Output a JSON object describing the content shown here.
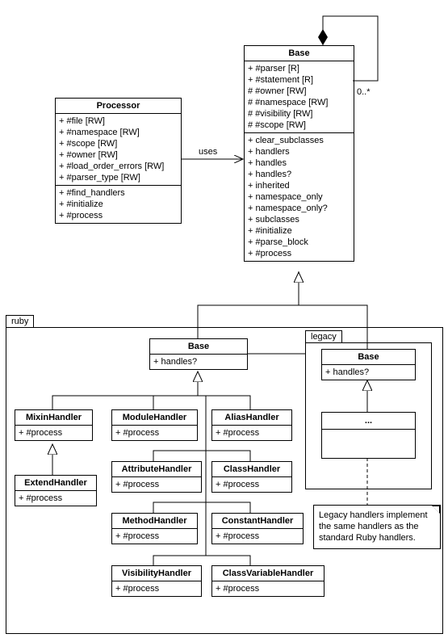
{
  "processor": {
    "title": "Processor",
    "attrs": [
      "+ #file [RW]",
      "+ #namespace [RW]",
      "+ #scope [RW]",
      "+ #owner [RW]",
      "+ #load_order_errors [RW]",
      "+ #parser_type [RW]"
    ],
    "ops": [
      "+ #find_handlers",
      "+ #initialize",
      "+ #process"
    ]
  },
  "base": {
    "title": "Base",
    "attrs": [
      "+ #parser [R]",
      "+ #statement [R]",
      "# #owner [RW]",
      "# #namespace [RW]",
      "# #visibility [RW]",
      "# #scope [RW]"
    ],
    "ops": [
      "+ clear_subclasses",
      "+ handlers",
      "+ handles",
      "+ handles?",
      "+ inherited",
      "+ namespace_only",
      "+ namespace_only?",
      "+ subclasses",
      "+ #initialize",
      "+ #parse_block",
      "+ #process"
    ]
  },
  "uses": "uses",
  "mult": "0..*",
  "ruby": {
    "label": "ruby",
    "base": {
      "title": "Base",
      "ops": [
        "+ handles?"
      ]
    },
    "h": {
      "mixin": {
        "t": "MixinHandler",
        "o": [
          "+ #process"
        ]
      },
      "extend": {
        "t": "ExtendHandler",
        "o": [
          "+ #process"
        ]
      },
      "module": {
        "t": "ModuleHandler",
        "o": [
          "+ #process"
        ]
      },
      "attribute": {
        "t": "AttributeHandler",
        "o": [
          "+ #process"
        ]
      },
      "method": {
        "t": "MethodHandler",
        "o": [
          "+ #process"
        ]
      },
      "visibility": {
        "t": "VisibilityHandler",
        "o": [
          "+ #process"
        ]
      },
      "alias": {
        "t": "AliasHandler",
        "o": [
          "+ #process"
        ]
      },
      "class": {
        "t": "ClassHandler",
        "o": [
          "+ #process"
        ]
      },
      "constant": {
        "t": "ConstantHandler",
        "o": [
          "+ #process"
        ]
      },
      "classvar": {
        "t": "ClassVariableHandler",
        "o": [
          "+ #process"
        ]
      }
    }
  },
  "legacy": {
    "label": "legacy",
    "base": {
      "title": "Base",
      "ops": [
        "+ handles?"
      ]
    },
    "placeholder": "..."
  },
  "note": "Legacy handlers implement the same handlers as the standard Ruby handlers."
}
